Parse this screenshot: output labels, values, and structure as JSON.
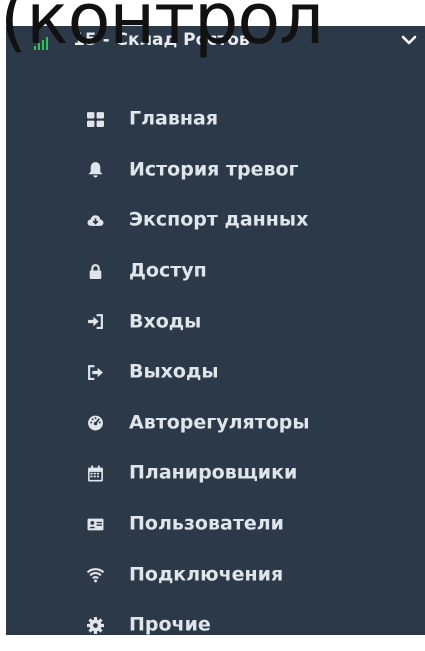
{
  "overlay": {
    "caption": "(контрол"
  },
  "header": {
    "title": "15 - Склад Ростов",
    "signal_color": "#30c25a"
  },
  "menu": {
    "items": [
      {
        "label": "Главная",
        "icon": "grid-icon"
      },
      {
        "label": "История тревог",
        "icon": "bell-icon"
      },
      {
        "label": "Экспорт данных",
        "icon": "cloud-download-icon"
      },
      {
        "label": "Доступ",
        "icon": "lock-icon"
      },
      {
        "label": "Входы",
        "icon": "sign-in-icon"
      },
      {
        "label": "Выходы",
        "icon": "sign-out-icon"
      },
      {
        "label": "Авторегуляторы",
        "icon": "gauge-icon"
      },
      {
        "label": "Планировщики",
        "icon": "calendar-icon"
      },
      {
        "label": "Пользователи",
        "icon": "id-card-icon"
      },
      {
        "label": "Подключения",
        "icon": "wifi-icon"
      },
      {
        "label": "Прочие",
        "icon": "gear-icon"
      }
    ]
  },
  "colors": {
    "sidebar_bg": "#2b3949",
    "text": "#dfe5ea"
  }
}
